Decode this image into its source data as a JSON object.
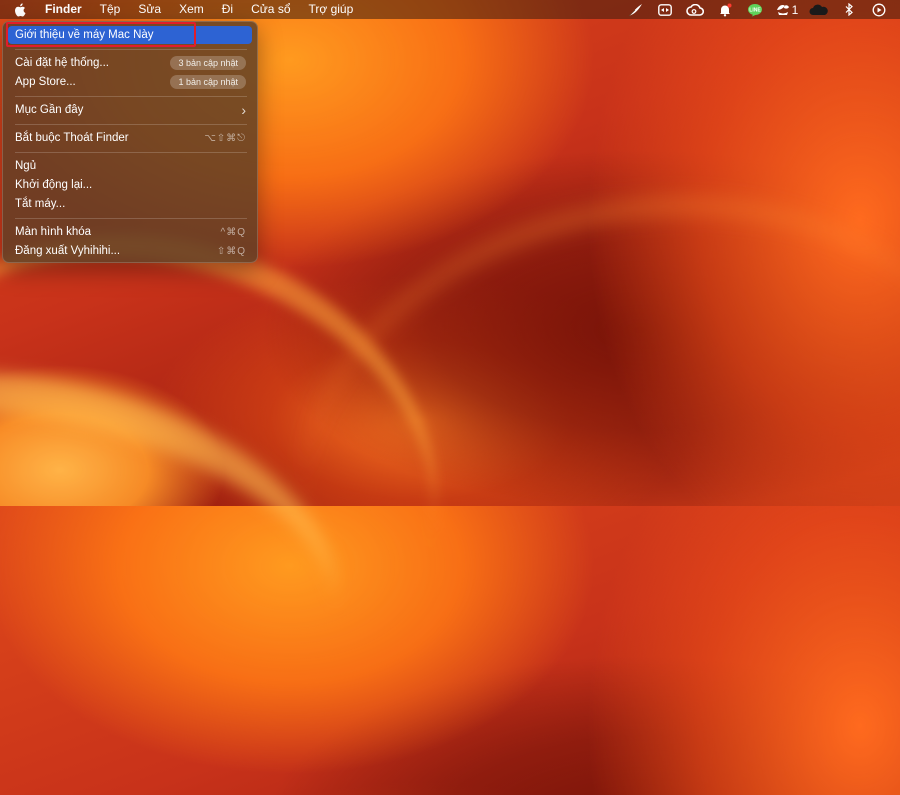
{
  "menubar": {
    "apple_icon": "apple-logo-icon",
    "app_name": "Finder",
    "items": [
      "Tệp",
      "Sửa",
      "Xem",
      "Đi",
      "Cửa sổ",
      "Trợ giúp"
    ],
    "tray": {
      "icons": [
        "feather-icon",
        "teamviewer-icon",
        "creative-cloud-icon",
        "notification-bell-icon",
        "line-icon",
        "plant-icon",
        "cloud-icon",
        "bluetooth-icon",
        "play-circle-icon"
      ],
      "plant_count": "1"
    }
  },
  "apple_menu": {
    "about": "Giới thiệu về máy Mac Này",
    "system_settings": "Cài đặt hệ thống...",
    "system_settings_badge": "3 bản cập nhật",
    "app_store": "App Store...",
    "app_store_badge": "1 bản cập nhật",
    "recent_items": "Mục Gần đây",
    "force_quit": "Bắt buộc Thoát Finder",
    "force_quit_shortcut": "⌥⇧⌘⎋",
    "sleep": "Ngủ",
    "restart": "Khởi động lại...",
    "shutdown": "Tắt máy...",
    "lock_screen": "Màn hình khóa",
    "lock_screen_shortcut": "^⌘Q",
    "logout": "Đăng xuất Vyhihihi...",
    "logout_shortcut": "⇧⌘Q"
  },
  "colors": {
    "selection": "#2d63d3",
    "highlight_border": "#e11d2a"
  }
}
